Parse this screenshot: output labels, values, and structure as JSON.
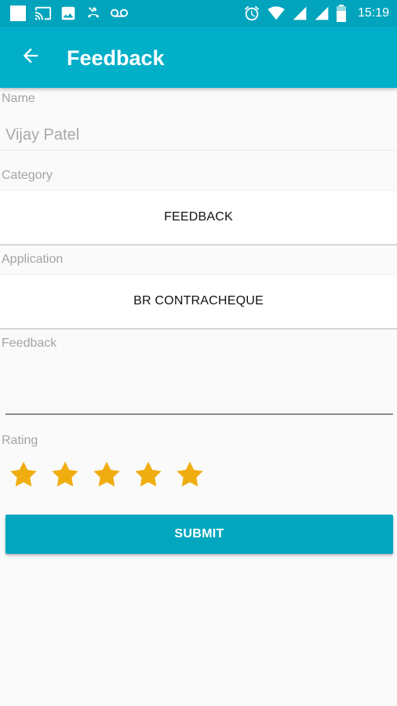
{
  "status_bar": {
    "time": "15:19",
    "left_icons": [
      "square-icon",
      "cast-icon",
      "image-icon",
      "missed-call-icon",
      "voicemail-icon"
    ],
    "right_icons": [
      "alarm-icon",
      "wifi-icon",
      "signal-icon",
      "signal-icon",
      "battery-icon"
    ]
  },
  "app_bar": {
    "title": "Feedback",
    "back_icon": "arrow-back-icon"
  },
  "form": {
    "name_label": "Name",
    "name_value": "Vijay Patel",
    "category_label": "Category",
    "category_value": "FEEDBACK",
    "application_label": "Application",
    "application_value": "BR CONTRACHEQUE",
    "feedback_label": "Feedback",
    "feedback_value": "",
    "rating_label": "Rating",
    "rating": {
      "value": 5,
      "max": 5
    },
    "submit_label": "SUBMIT"
  },
  "colors": {
    "status_bar": "#02a4bd",
    "app_bar": "#02afc8",
    "accent": "#03a6bf",
    "star": "#f0ad10"
  }
}
